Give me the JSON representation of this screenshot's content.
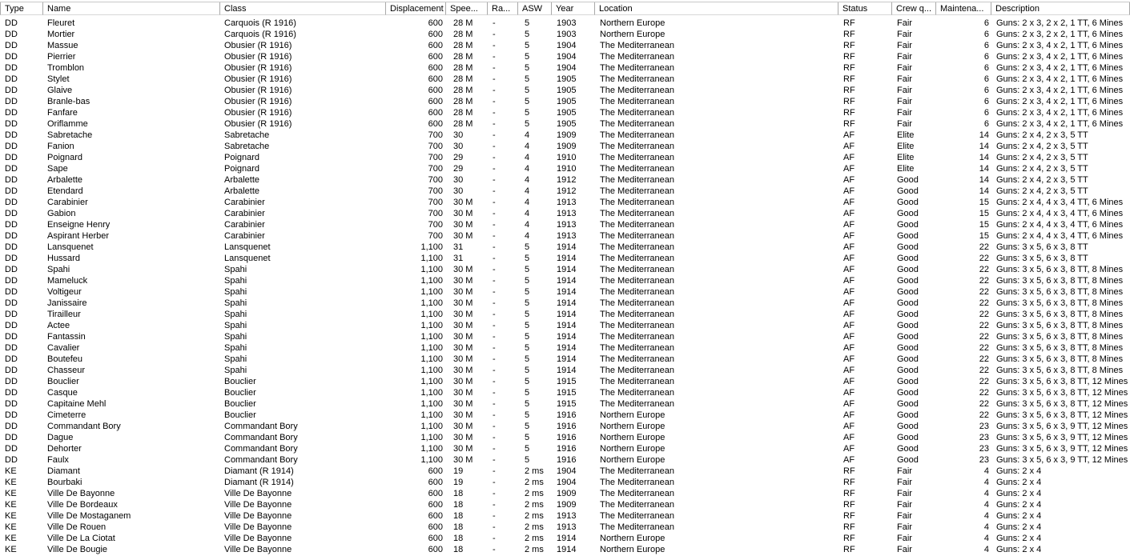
{
  "columns": [
    {
      "key": "type",
      "label": "Type"
    },
    {
      "key": "name",
      "label": "Name"
    },
    {
      "key": "class",
      "label": "Class"
    },
    {
      "key": "displacement",
      "label": "Displacement"
    },
    {
      "key": "speed",
      "label": "Spee..."
    },
    {
      "key": "range",
      "label": "Ra..."
    },
    {
      "key": "asw",
      "label": "ASW"
    },
    {
      "key": "year",
      "label": "Year"
    },
    {
      "key": "location",
      "label": "Location"
    },
    {
      "key": "status",
      "label": "Status"
    },
    {
      "key": "crew",
      "label": "Crew q..."
    },
    {
      "key": "maintenance",
      "label": "Maintena..."
    },
    {
      "key": "description",
      "label": "Description"
    }
  ],
  "rows": [
    [
      "DD",
      "Fleuret",
      "Carquois (R 1916)",
      "600",
      "28 M",
      "-",
      "5",
      "1903",
      "Northern Europe",
      "RF",
      "Fair",
      "6",
      "Guns: 2 x 3, 2 x 2, 1 TT, 6 Mines"
    ],
    [
      "DD",
      "Mortier",
      "Carquois (R 1916)",
      "600",
      "28 M",
      "-",
      "5",
      "1903",
      "Northern Europe",
      "RF",
      "Fair",
      "6",
      "Guns: 2 x 3, 2 x 2, 1 TT, 6 Mines"
    ],
    [
      "DD",
      "Massue",
      "Obusier (R 1916)",
      "600",
      "28 M",
      "-",
      "5",
      "1904",
      "The Mediterranean",
      "RF",
      "Fair",
      "6",
      "Guns: 2 x 3, 4 x 2, 1 TT, 6 Mines"
    ],
    [
      "DD",
      "Pierrier",
      "Obusier (R 1916)",
      "600",
      "28 M",
      "-",
      "5",
      "1904",
      "The Mediterranean",
      "RF",
      "Fair",
      "6",
      "Guns: 2 x 3, 4 x 2, 1 TT, 6 Mines"
    ],
    [
      "DD",
      "Tromblon",
      "Obusier (R 1916)",
      "600",
      "28 M",
      "-",
      "5",
      "1904",
      "The Mediterranean",
      "RF",
      "Fair",
      "6",
      "Guns: 2 x 3, 4 x 2, 1 TT, 6 Mines"
    ],
    [
      "DD",
      "Stylet",
      "Obusier (R 1916)",
      "600",
      "28 M",
      "-",
      "5",
      "1905",
      "The Mediterranean",
      "RF",
      "Fair",
      "6",
      "Guns: 2 x 3, 4 x 2, 1 TT, 6 Mines"
    ],
    [
      "DD",
      "Glaive",
      "Obusier (R 1916)",
      "600",
      "28 M",
      "-",
      "5",
      "1905",
      "The Mediterranean",
      "RF",
      "Fair",
      "6",
      "Guns: 2 x 3, 4 x 2, 1 TT, 6 Mines"
    ],
    [
      "DD",
      "Branle-bas",
      "Obusier (R 1916)",
      "600",
      "28 M",
      "-",
      "5",
      "1905",
      "The Mediterranean",
      "RF",
      "Fair",
      "6",
      "Guns: 2 x 3, 4 x 2, 1 TT, 6 Mines"
    ],
    [
      "DD",
      "Fanfare",
      "Obusier (R 1916)",
      "600",
      "28 M",
      "-",
      "5",
      "1905",
      "The Mediterranean",
      "RF",
      "Fair",
      "6",
      "Guns: 2 x 3, 4 x 2, 1 TT, 6 Mines"
    ],
    [
      "DD",
      "Oriflamme",
      "Obusier (R 1916)",
      "600",
      "28 M",
      "-",
      "5",
      "1905",
      "The Mediterranean",
      "RF",
      "Fair",
      "6",
      "Guns: 2 x 3, 4 x 2, 1 TT, 6 Mines"
    ],
    [
      "DD",
      "Sabretache",
      "Sabretache",
      "700",
      "30",
      "-",
      "4",
      "1909",
      "The Mediterranean",
      "AF",
      "Elite",
      "14",
      "Guns: 2 x 4, 2 x 3, 5 TT"
    ],
    [
      "DD",
      "Fanion",
      "Sabretache",
      "700",
      "30",
      "-",
      "4",
      "1909",
      "The Mediterranean",
      "AF",
      "Elite",
      "14",
      "Guns: 2 x 4, 2 x 3, 5 TT"
    ],
    [
      "DD",
      "Poignard",
      "Poignard",
      "700",
      "29",
      "-",
      "4",
      "1910",
      "The Mediterranean",
      "AF",
      "Elite",
      "14",
      "Guns: 2 x 4, 2 x 3, 5 TT"
    ],
    [
      "DD",
      "Sape",
      "Poignard",
      "700",
      "29",
      "-",
      "4",
      "1910",
      "The Mediterranean",
      "AF",
      "Elite",
      "14",
      "Guns: 2 x 4, 2 x 3, 5 TT"
    ],
    [
      "DD",
      "Arbalette",
      "Arbalette",
      "700",
      "30",
      "-",
      "4",
      "1912",
      "The Mediterranean",
      "AF",
      "Good",
      "14",
      "Guns: 2 x 4, 2 x 3, 5 TT"
    ],
    [
      "DD",
      "Etendard",
      "Arbalette",
      "700",
      "30",
      "-",
      "4",
      "1912",
      "The Mediterranean",
      "AF",
      "Good",
      "14",
      "Guns: 2 x 4, 2 x 3, 5 TT"
    ],
    [
      "DD",
      "Carabinier",
      "Carabinier",
      "700",
      "30 M",
      "-",
      "4",
      "1913",
      "The Mediterranean",
      "AF",
      "Good",
      "15",
      "Guns: 2 x 4, 4 x 3, 4 TT, 6 Mines"
    ],
    [
      "DD",
      "Gabion",
      "Carabinier",
      "700",
      "30 M",
      "-",
      "4",
      "1913",
      "The Mediterranean",
      "AF",
      "Good",
      "15",
      "Guns: 2 x 4, 4 x 3, 4 TT, 6 Mines"
    ],
    [
      "DD",
      "Enseigne Henry",
      "Carabinier",
      "700",
      "30 M",
      "-",
      "4",
      "1913",
      "The Mediterranean",
      "AF",
      "Good",
      "15",
      "Guns: 2 x 4, 4 x 3, 4 TT, 6 Mines"
    ],
    [
      "DD",
      "Aspirant Herber",
      "Carabinier",
      "700",
      "30 M",
      "-",
      "4",
      "1913",
      "The Mediterranean",
      "AF",
      "Good",
      "15",
      "Guns: 2 x 4, 4 x 3, 4 TT, 6 Mines"
    ],
    [
      "DD",
      "Lansquenet",
      "Lansquenet",
      "1,100",
      "31",
      "-",
      "5",
      "1914",
      "The Mediterranean",
      "AF",
      "Good",
      "22",
      "Guns: 3 x 5, 6 x 3, 8 TT"
    ],
    [
      "DD",
      "Hussard",
      "Lansquenet",
      "1,100",
      "31",
      "-",
      "5",
      "1914",
      "The Mediterranean",
      "AF",
      "Good",
      "22",
      "Guns: 3 x 5, 6 x 3, 8 TT"
    ],
    [
      "DD",
      "Spahi",
      "Spahi",
      "1,100",
      "30 M",
      "-",
      "5",
      "1914",
      "The Mediterranean",
      "AF",
      "Good",
      "22",
      "Guns: 3 x 5, 6 x 3, 8 TT, 8 Mines"
    ],
    [
      "DD",
      "Mameluck",
      "Spahi",
      "1,100",
      "30 M",
      "-",
      "5",
      "1914",
      "The Mediterranean",
      "AF",
      "Good",
      "22",
      "Guns: 3 x 5, 6 x 3, 8 TT, 8 Mines"
    ],
    [
      "DD",
      "Voltigeur",
      "Spahi",
      "1,100",
      "30 M",
      "-",
      "5",
      "1914",
      "The Mediterranean",
      "AF",
      "Good",
      "22",
      "Guns: 3 x 5, 6 x 3, 8 TT, 8 Mines"
    ],
    [
      "DD",
      "Janissaire",
      "Spahi",
      "1,100",
      "30 M",
      "-",
      "5",
      "1914",
      "The Mediterranean",
      "AF",
      "Good",
      "22",
      "Guns: 3 x 5, 6 x 3, 8 TT, 8 Mines"
    ],
    [
      "DD",
      "Tirailleur",
      "Spahi",
      "1,100",
      "30 M",
      "-",
      "5",
      "1914",
      "The Mediterranean",
      "AF",
      "Good",
      "22",
      "Guns: 3 x 5, 6 x 3, 8 TT, 8 Mines"
    ],
    [
      "DD",
      "Actee",
      "Spahi",
      "1,100",
      "30 M",
      "-",
      "5",
      "1914",
      "The Mediterranean",
      "AF",
      "Good",
      "22",
      "Guns: 3 x 5, 6 x 3, 8 TT, 8 Mines"
    ],
    [
      "DD",
      "Fantassin",
      "Spahi",
      "1,100",
      "30 M",
      "-",
      "5",
      "1914",
      "The Mediterranean",
      "AF",
      "Good",
      "22",
      "Guns: 3 x 5, 6 x 3, 8 TT, 8 Mines"
    ],
    [
      "DD",
      "Cavalier",
      "Spahi",
      "1,100",
      "30 M",
      "-",
      "5",
      "1914",
      "The Mediterranean",
      "AF",
      "Good",
      "22",
      "Guns: 3 x 5, 6 x 3, 8 TT, 8 Mines"
    ],
    [
      "DD",
      "Boutefeu",
      "Spahi",
      "1,100",
      "30 M",
      "-",
      "5",
      "1914",
      "The Mediterranean",
      "AF",
      "Good",
      "22",
      "Guns: 3 x 5, 6 x 3, 8 TT, 8 Mines"
    ],
    [
      "DD",
      "Chasseur",
      "Spahi",
      "1,100",
      "30 M",
      "-",
      "5",
      "1914",
      "The Mediterranean",
      "AF",
      "Good",
      "22",
      "Guns: 3 x 5, 6 x 3, 8 TT, 8 Mines"
    ],
    [
      "DD",
      "Bouclier",
      "Bouclier",
      "1,100",
      "30 M",
      "-",
      "5",
      "1915",
      "The Mediterranean",
      "AF",
      "Good",
      "22",
      "Guns: 3 x 5, 6 x 3, 8 TT, 12 Mines"
    ],
    [
      "DD",
      "Casque",
      "Bouclier",
      "1,100",
      "30 M",
      "-",
      "5",
      "1915",
      "The Mediterranean",
      "AF",
      "Good",
      "22",
      "Guns: 3 x 5, 6 x 3, 8 TT, 12 Mines"
    ],
    [
      "DD",
      "Capitaine Mehl",
      "Bouclier",
      "1,100",
      "30 M",
      "-",
      "5",
      "1915",
      "The Mediterranean",
      "AF",
      "Good",
      "22",
      "Guns: 3 x 5, 6 x 3, 8 TT, 12 Mines"
    ],
    [
      "DD",
      "Cimeterre",
      "Bouclier",
      "1,100",
      "30 M",
      "-",
      "5",
      "1916",
      "Northern Europe",
      "AF",
      "Good",
      "22",
      "Guns: 3 x 5, 6 x 3, 8 TT, 12 Mines"
    ],
    [
      "DD",
      "Commandant Bory",
      "Commandant Bory",
      "1,100",
      "30 M",
      "-",
      "5",
      "1916",
      "Northern Europe",
      "AF",
      "Good",
      "23",
      "Guns: 3 x 5, 6 x 3, 9 TT, 12 Mines"
    ],
    [
      "DD",
      "Dague",
      "Commandant Bory",
      "1,100",
      "30 M",
      "-",
      "5",
      "1916",
      "Northern Europe",
      "AF",
      "Good",
      "23",
      "Guns: 3 x 5, 6 x 3, 9 TT, 12 Mines"
    ],
    [
      "DD",
      "Dehorter",
      "Commandant Bory",
      "1,100",
      "30 M",
      "-",
      "5",
      "1916",
      "Northern Europe",
      "AF",
      "Good",
      "23",
      "Guns: 3 x 5, 6 x 3, 9 TT, 12 Mines"
    ],
    [
      "DD",
      "Faulx",
      "Commandant Bory",
      "1,100",
      "30 M",
      "-",
      "5",
      "1916",
      "Northern Europe",
      "AF",
      "Good",
      "23",
      "Guns: 3 x 5, 6 x 3, 9 TT, 12 Mines"
    ],
    [
      "KE",
      "Diamant",
      "Diamant (R 1914)",
      "600",
      "19",
      "-",
      "2 ms",
      "1904",
      "The Mediterranean",
      "RF",
      "Fair",
      "4",
      "Guns: 2 x 4"
    ],
    [
      "KE",
      "Bourbaki",
      "Diamant (R 1914)",
      "600",
      "19",
      "-",
      "2 ms",
      "1904",
      "The Mediterranean",
      "RF",
      "Fair",
      "4",
      "Guns: 2 x 4"
    ],
    [
      "KE",
      "Ville De Bayonne",
      "Ville De Bayonne",
      "600",
      "18",
      "-",
      "2 ms",
      "1909",
      "The Mediterranean",
      "RF",
      "Fair",
      "4",
      "Guns: 2 x 4"
    ],
    [
      "KE",
      "Ville De Bordeaux",
      "Ville De Bayonne",
      "600",
      "18",
      "-",
      "2 ms",
      "1909",
      "The Mediterranean",
      "RF",
      "Fair",
      "4",
      "Guns: 2 x 4"
    ],
    [
      "KE",
      "Ville De Mostaganem",
      "Ville De Bayonne",
      "600",
      "18",
      "-",
      "2 ms",
      "1913",
      "The Mediterranean",
      "RF",
      "Fair",
      "4",
      "Guns: 2 x 4"
    ],
    [
      "KE",
      "Ville De Rouen",
      "Ville De Bayonne",
      "600",
      "18",
      "-",
      "2 ms",
      "1913",
      "The Mediterranean",
      "RF",
      "Fair",
      "4",
      "Guns: 2 x 4"
    ],
    [
      "KE",
      "Ville De La Ciotat",
      "Ville De Bayonne",
      "600",
      "18",
      "-",
      "2 ms",
      "1914",
      "Northern Europe",
      "RF",
      "Fair",
      "4",
      "Guns: 2 x 4"
    ],
    [
      "KE",
      "Ville De Bougie",
      "Ville De Bayonne",
      "600",
      "18",
      "-",
      "2 ms",
      "1914",
      "Northern Europe",
      "RF",
      "Fair",
      "4",
      "Guns: 2 x 4"
    ]
  ]
}
